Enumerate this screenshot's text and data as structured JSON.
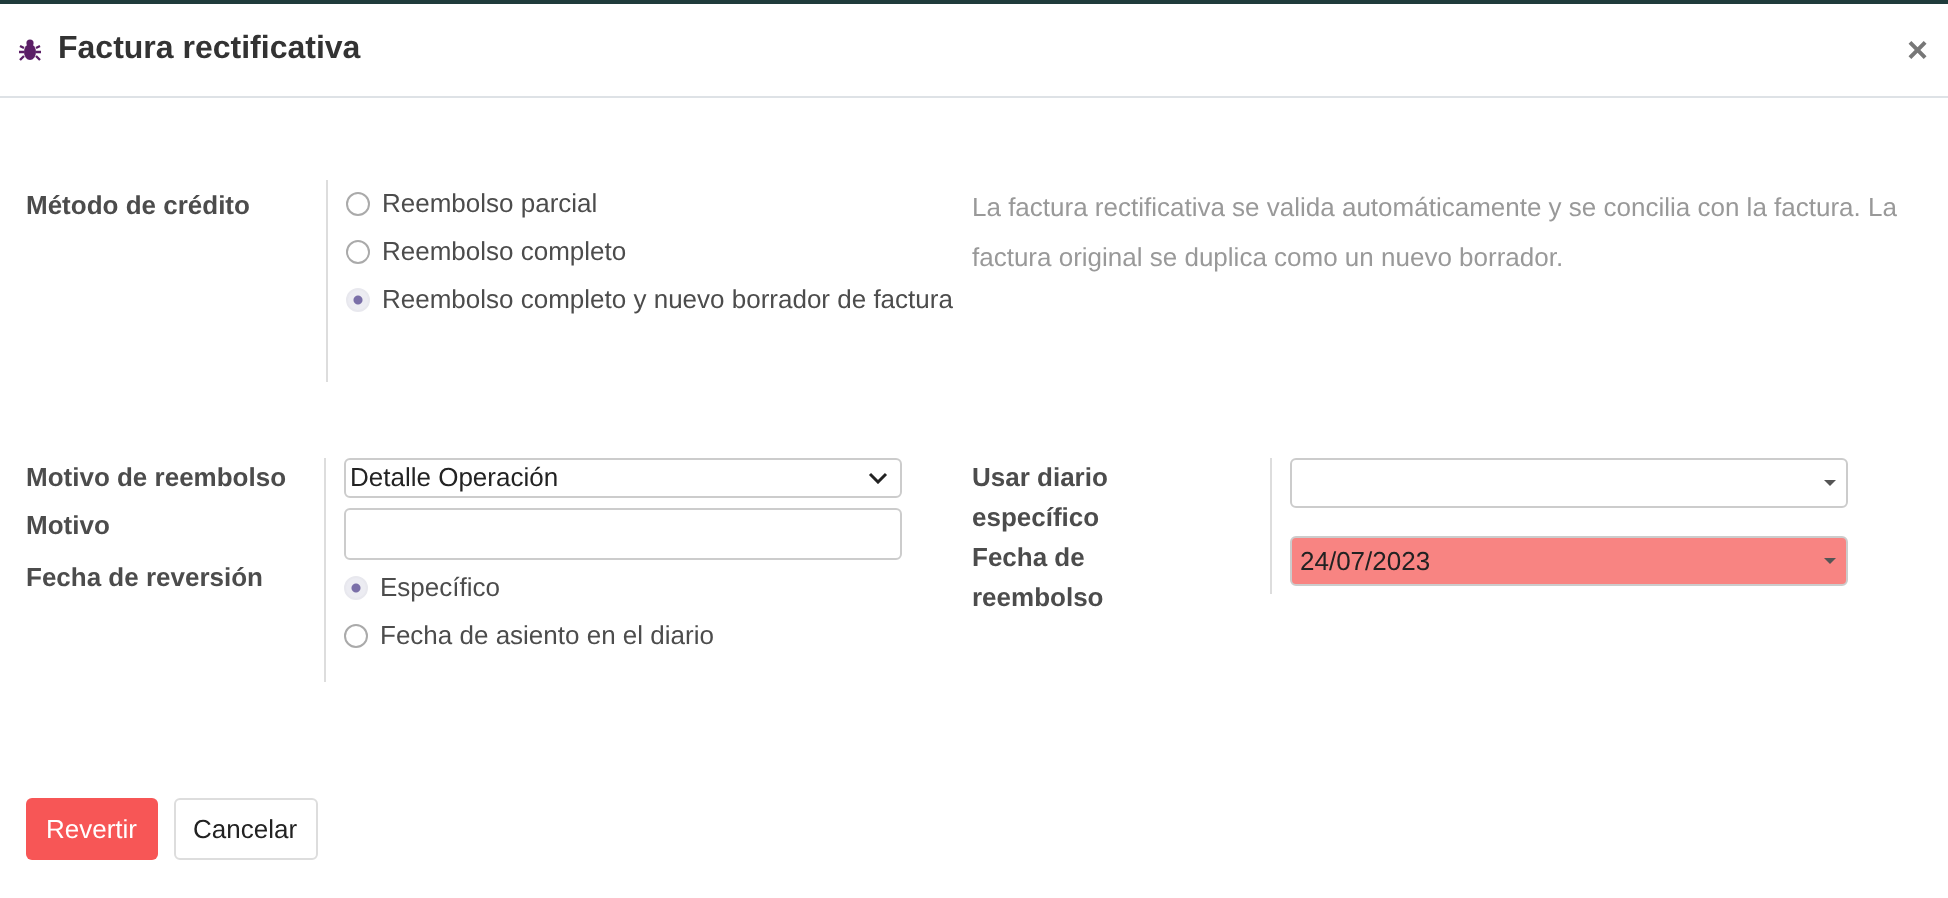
{
  "dialog": {
    "title": "Factura rectificativa",
    "close": "×"
  },
  "credit_method": {
    "label": "Método de crédito",
    "options": [
      {
        "label": "Reembolso parcial",
        "selected": false
      },
      {
        "label": "Reembolso completo",
        "selected": false
      },
      {
        "label": "Reembolso completo y nuevo borrador de factura",
        "selected": true
      }
    ],
    "help": "La factura rectificativa se valida automáticamente y se concilia con la factura. La factura original se duplica como un nuevo borrador."
  },
  "left_fields": [
    {
      "kind": "select",
      "label": "Motivo de reembolso",
      "value": "Detalle Operación"
    },
    {
      "kind": "text",
      "label": "Motivo"
    },
    {
      "kind": "radio",
      "label": "Fecha de reversión",
      "options": [
        {
          "label": "Específico",
          "selected": true
        },
        {
          "label": "Fecha de asiento en el diario",
          "selected": false
        }
      ]
    }
  ],
  "right_fields": [
    {
      "label": "Usar diario específico",
      "invalid": false
    },
    {
      "label": "Fecha de reembolso",
      "value": "24/07/2023",
      "invalid": true
    }
  ],
  "buttons": [
    {
      "label": "Revertir",
      "primary": true
    },
    {
      "label": "Cancelar",
      "primary": false
    }
  ]
}
